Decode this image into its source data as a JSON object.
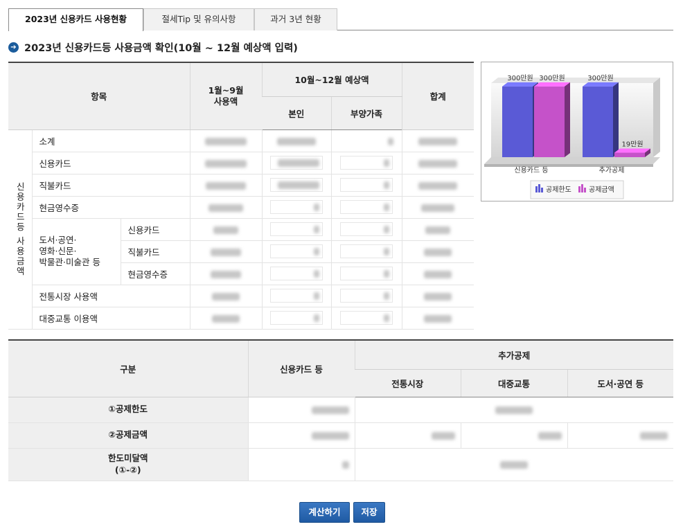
{
  "tabs": [
    {
      "label": "2023년 신용카드 사용현황"
    },
    {
      "label": "절세Tip 및 유의사항"
    },
    {
      "label": "과거 3년 현황"
    }
  ],
  "section_title": "2023년 신용카드등 사용금액 확인(10월 ~ 12월 예상액 입력)",
  "usage_table": {
    "headers": {
      "item": "항목",
      "jan_sep": "1월~9월\n사용액",
      "oct_dec": "10월~12월 예상액",
      "self": "본인",
      "dependent": "부양가족",
      "total": "합계"
    },
    "group_label": "신용카드등 사용금액",
    "rows": {
      "subtotal": "소계",
      "credit_card": "신용카드",
      "debit_card": "직불카드",
      "cash_receipt": "현금영수증",
      "culture_group": "도서·공연·\n영화·신문·\n박물관·미술관 등",
      "culture_credit": "신용카드",
      "culture_debit": "직불카드",
      "culture_cash": "현금영수증",
      "market": "전통시장 사용액",
      "transit": "대중교통 이용액"
    }
  },
  "chart_data": {
    "type": "bar",
    "categories": [
      "신용카드 등",
      "추가공제"
    ],
    "series": [
      {
        "name": "공제한도",
        "values": [
          300,
          300
        ],
        "color": "#5a5ad6"
      },
      {
        "name": "공제금액",
        "values": [
          300,
          19
        ],
        "color": "#c552c9"
      }
    ],
    "data_labels": {
      "a1": "300만원",
      "b1": "300만원",
      "a2": "300만원",
      "b2": "19만원"
    },
    "ylim": [
      0,
      320
    ],
    "legend": "bottom"
  },
  "deduction_table": {
    "headers": {
      "category": "구분",
      "credit_etc": "신용카드 등",
      "additional": "추가공제",
      "market": "전통시장",
      "transit": "대중교통",
      "culture": "도서·공연 등"
    },
    "rows": {
      "limit": "①공제한도",
      "amount": "②공제금액",
      "shortfall": "한도미달액\n(①-②)"
    }
  },
  "buttons": {
    "calculate": "계산하기",
    "save": "저장"
  }
}
